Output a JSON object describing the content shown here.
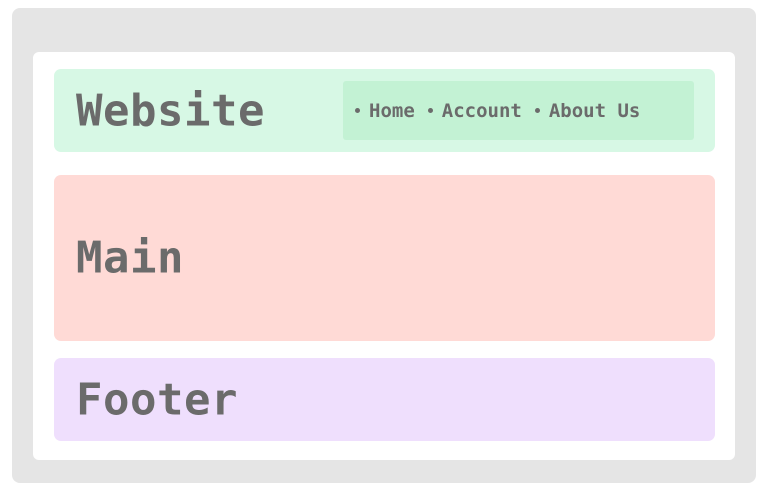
{
  "colors": {
    "frame": "#e5e5e5",
    "canvas": "#ffffff",
    "header": "#d7f8e5",
    "nav": "#c3f2d4",
    "main": "#ffdad6",
    "footer": "#efdffd",
    "text": "#6b6b6b"
  },
  "header": {
    "title": "Website",
    "nav": [
      {
        "label": "Home",
        "icon": "bullet-icon"
      },
      {
        "label": "Account",
        "icon": "bullet-icon"
      },
      {
        "label": "About Us",
        "icon": "bullet-icon"
      }
    ]
  },
  "main": {
    "label": "Main"
  },
  "footer": {
    "label": "Footer"
  }
}
